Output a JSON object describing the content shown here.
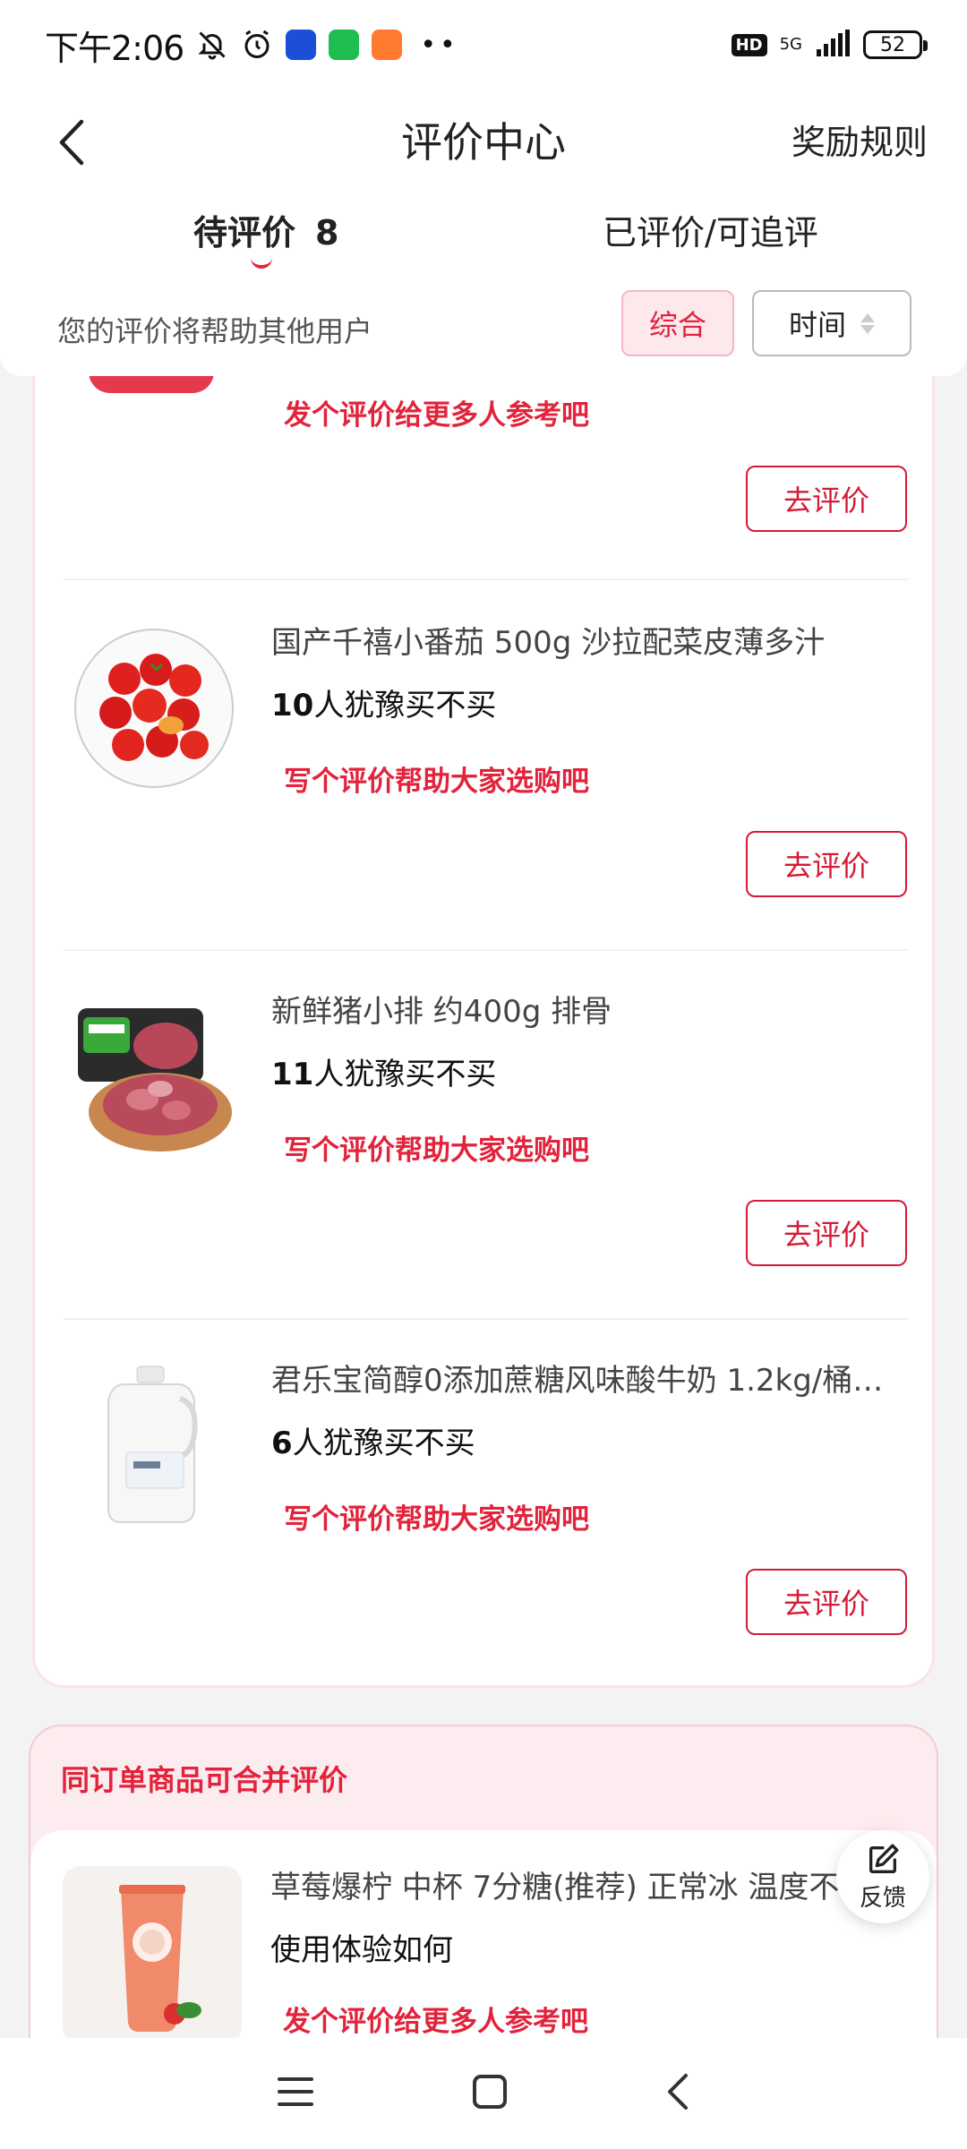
{
  "status_bar": {
    "time": "下午2:06",
    "network": "5G",
    "battery": "52",
    "hd": "HD"
  },
  "header": {
    "title": "评价中心",
    "reward_rules": "奖励规则",
    "tabs": [
      {
        "label": "待评价",
        "count": "8"
      },
      {
        "label": "已评价/可追评"
      }
    ],
    "hint": "您的评价将帮助其他用户",
    "sort": {
      "comprehensive": "综合",
      "time": "时间"
    }
  },
  "list": {
    "partial_item_cta": "发个评价给更多人参考吧",
    "review_button": "去评价",
    "items": [
      {
        "title": "国产千禧小番茄 500g 沙拉配菜皮薄多汁",
        "hesitate_count": "10",
        "hesitate_text": "人犹豫买不买",
        "cta": "写个评价帮助大家选购吧"
      },
      {
        "title": "新鲜猪小排 约400g 排骨",
        "hesitate_count": "11",
        "hesitate_text": "人犹豫买不买",
        "cta": "写个评价帮助大家选购吧"
      },
      {
        "title": "君乐宝简醇0添加蔗糖风味酸牛奶 1.2kg/桶…",
        "hesitate_count": "6",
        "hesitate_text": "人犹豫买不买",
        "cta": "写个评价帮助大家选购吧"
      }
    ]
  },
  "merge_section": {
    "title": "同订单商品可合并评价",
    "item": {
      "title": "草莓爆柠 中杯 7分糖(推荐) 正常冰 温度不",
      "question": "使用体验如何",
      "cta": "发个评价给更多人参考吧"
    }
  },
  "feedback": {
    "label": "反馈"
  },
  "colors": {
    "accent": "#e2233b",
    "pink_bg": "#fdecef"
  }
}
